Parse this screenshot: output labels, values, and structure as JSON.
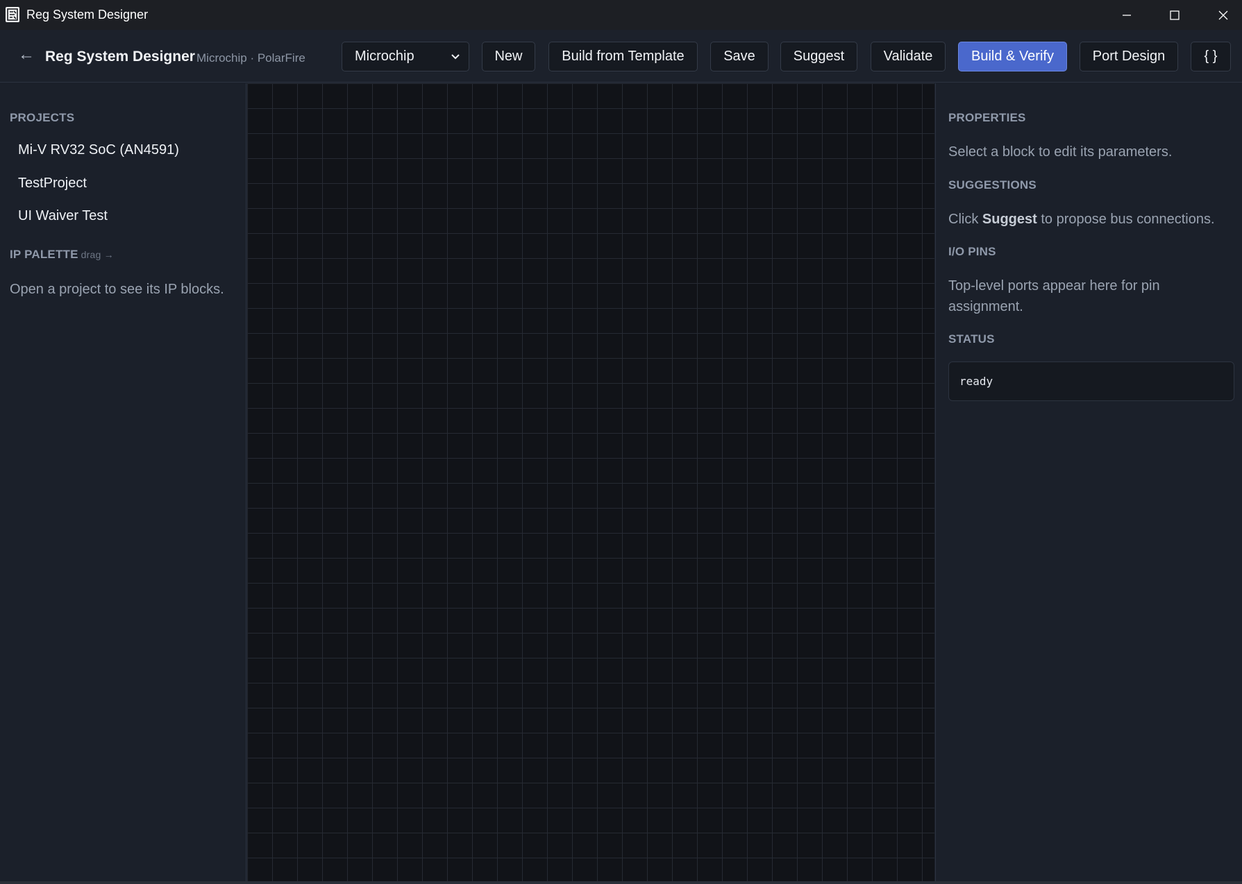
{
  "window": {
    "title": "Reg System Designer",
    "icon": "app-icon"
  },
  "toolbar": {
    "back_glyph": "←",
    "app_name": "Reg System Designer",
    "subtitle": "Microchip · PolarFire",
    "vendor_select": {
      "value": "Microchip"
    },
    "buttons": {
      "new": "New",
      "build_from_template": "Build from Template",
      "save": "Save",
      "suggest": "Suggest",
      "validate": "Validate",
      "build_verify": "Build & Verify",
      "port_design": "Port Design",
      "json": "{ }"
    },
    "accent_color": "#4a68cc"
  },
  "sidebar": {
    "projects_heading": "PROJECTS",
    "projects": [
      {
        "label": "Mi-V RV32 SoC (AN4591)"
      },
      {
        "label": "TestProject"
      },
      {
        "label": "UI Waiver Test"
      }
    ],
    "palette_heading": "IP PALETTE",
    "palette_hint": "drag →",
    "palette_empty": "Open a project to see its IP blocks."
  },
  "right_panel": {
    "properties_heading": "PROPERTIES",
    "properties_text": "Select a block to edit its parameters.",
    "suggestions_heading": "SUGGESTIONS",
    "suggestions_prefix": "Click ",
    "suggestions_bold": "Suggest",
    "suggestions_suffix": " to propose bus connections.",
    "io_heading": "I/O PINS",
    "io_text": "Top-level ports appear here for pin assignment.",
    "status_heading": "STATUS",
    "status_value": "ready"
  }
}
